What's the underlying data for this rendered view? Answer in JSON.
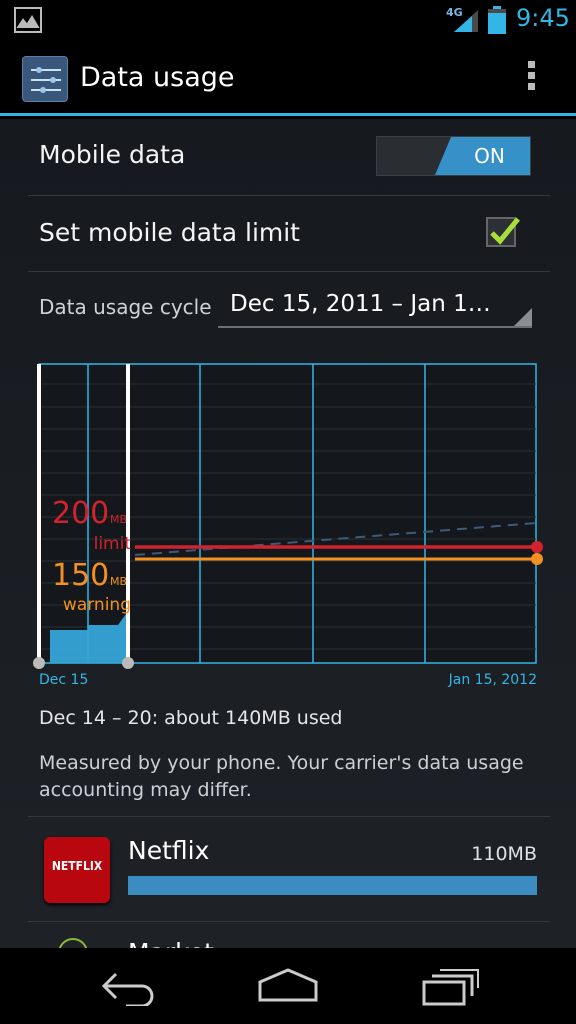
{
  "status_bar": {
    "network": "4G",
    "time": "9:45"
  },
  "action_bar": {
    "title": "Data usage",
    "app_icon": "settings-sliders-icon",
    "overflow_icon": "overflow-menu-icon"
  },
  "settings": {
    "mobile_data_label": "Mobile data",
    "mobile_data_state": "ON",
    "limit_label": "Set mobile data limit",
    "limit_checked": true,
    "cycle_label": "Data usage cycle",
    "cycle_value": "Dec 15, 2011 – Jan 1…"
  },
  "chart_data": {
    "type": "area",
    "x_start_label": "Dec 15",
    "x_end_label": "Jan 15, 2012",
    "limit": {
      "value": "200",
      "unit": "MB",
      "caption": "limit",
      "color": "#d2222d"
    },
    "warning": {
      "value": "150",
      "unit": "MB",
      "caption": "warning",
      "color": "#f39021"
    },
    "usage_color": "#35a4d8",
    "axis_color": "#33b5e5"
  },
  "summary": "Dec 14 – 20: about 140MB used",
  "note": "Measured by your phone. Your carrier's data usage accounting may differ.",
  "apps": [
    {
      "name": "Netflix",
      "size": "110MB",
      "icon_text": "NETFLIX",
      "bar_fraction": 1.0
    },
    {
      "name": "Market",
      "icon": "market-app-icon"
    }
  ],
  "nav": {
    "back_icon": "back-icon",
    "home_icon": "home-icon",
    "recents_icon": "recent-apps-icon"
  }
}
